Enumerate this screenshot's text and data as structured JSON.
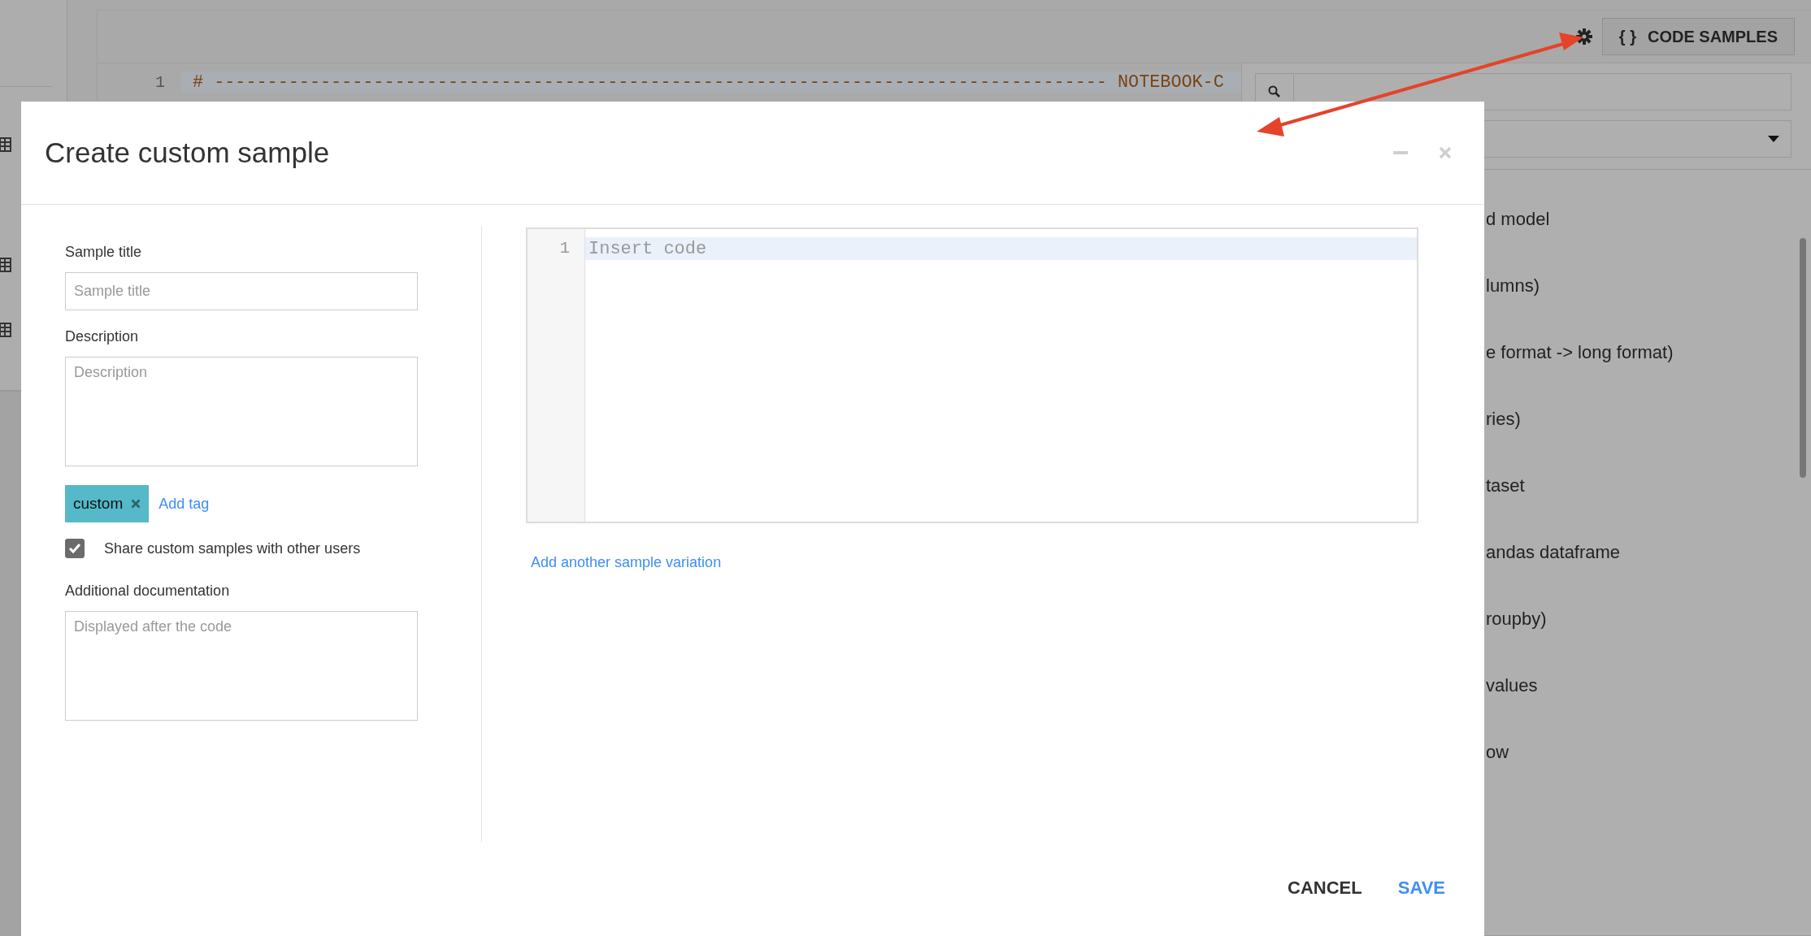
{
  "background": {
    "toolbar": {
      "code_samples_button": {
        "icon": "{ }",
        "label": "CODE SAMPLES"
      }
    },
    "code_lines": [
      {
        "number": "1",
        "text": "# ------------------------------------------------------------------------------------ NOTEBOOK-C"
      }
    ],
    "samples_panel": {
      "items": [
        "d model",
        "lumns)",
        "e format -> long format)",
        "ries)",
        "taset",
        "andas dataframe",
        "roupby)",
        "values",
        "ow"
      ]
    }
  },
  "dialog": {
    "title": "Create custom sample",
    "fields": [
      {
        "label": "Sample title",
        "placeholder": "Sample title",
        "kind": "input"
      },
      {
        "label": "Description",
        "placeholder": "Description",
        "kind": "textarea"
      }
    ],
    "tags": [
      {
        "label": "custom"
      }
    ],
    "add_tag": "Add tag",
    "share": {
      "label": "Share custom samples with other users",
      "checked": true
    },
    "documentation": {
      "label": "Additional documentation",
      "placeholder": "Displayed after the code"
    },
    "editor": {
      "line_number": "1",
      "placeholder": "Insert code"
    },
    "add_variation": "Add another sample variation",
    "buttons": [
      {
        "label": "CANCEL",
        "kind": "secondary"
      },
      {
        "label": "SAVE",
        "kind": "primary"
      }
    ]
  }
}
